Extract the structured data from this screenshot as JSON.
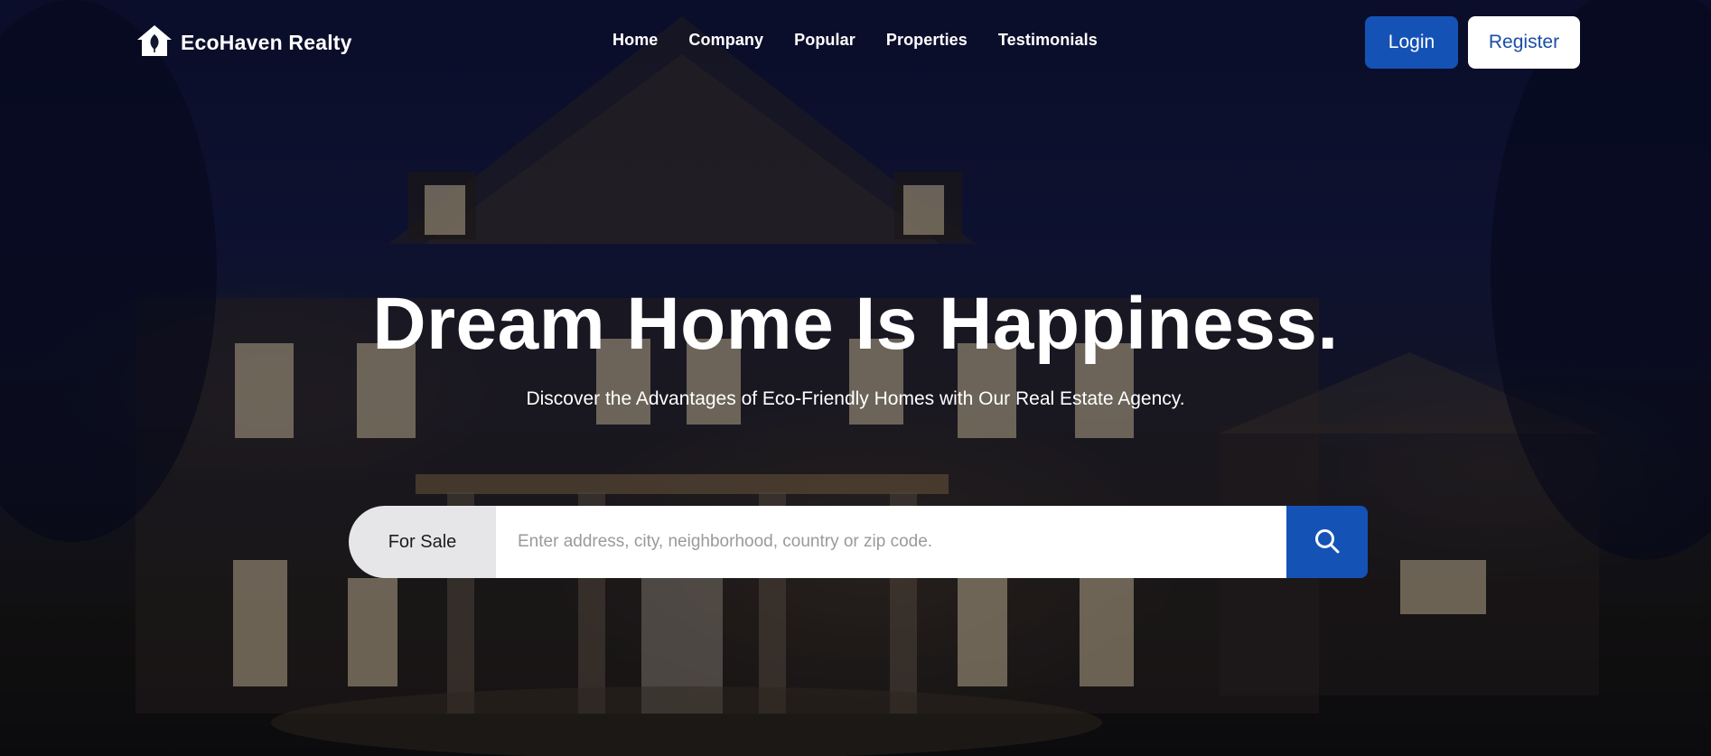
{
  "brand": {
    "name": "EcoHaven Realty",
    "icon": "house-leaf-icon"
  },
  "nav": {
    "items": [
      {
        "label": "Home"
      },
      {
        "label": "Company"
      },
      {
        "label": "Popular"
      },
      {
        "label": "Properties"
      },
      {
        "label": "Testimonials"
      }
    ]
  },
  "auth": {
    "login_label": "Login",
    "register_label": "Register"
  },
  "hero": {
    "headline": "Dream Home Is Happiness.",
    "subheadline": "Discover the Advantages of Eco-Friendly Homes with Our Real Estate Agency."
  },
  "search": {
    "mode_label": "For Sale",
    "placeholder": "Enter address, city, neighborhood, country or zip code.",
    "value": "",
    "button_icon": "search-icon"
  },
  "colors": {
    "accent": "#1552b5",
    "register_text": "#1a4ea6",
    "mode_bg": "#e6e6e8"
  }
}
